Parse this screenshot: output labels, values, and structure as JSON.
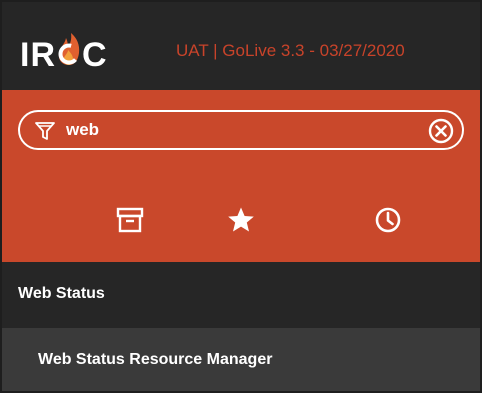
{
  "header": {
    "logo": {
      "text_left": "IR",
      "text_right": "C",
      "icon": "flame-icon"
    },
    "environment_label": "UAT | GoLive 3.3 - 03/27/2020"
  },
  "search": {
    "value": "web",
    "filter_icon": "filter-icon",
    "clear_icon": "close-circle-icon"
  },
  "tabs": [
    {
      "name": "archive",
      "icon": "archive-box-icon"
    },
    {
      "name": "favorites",
      "icon": "star-icon"
    },
    {
      "name": "recent",
      "icon": "clock-icon"
    }
  ],
  "results": {
    "section": {
      "label": "Web Status"
    },
    "items": [
      {
        "label": "Web Status Resource Manager"
      }
    ]
  },
  "colors": {
    "header_bg": "#262626",
    "accent": "#c9482b",
    "environment_label": "#c8432a",
    "section_bg": "#262626",
    "item_bg": "#3a3a3a",
    "text": "#ffffff"
  }
}
